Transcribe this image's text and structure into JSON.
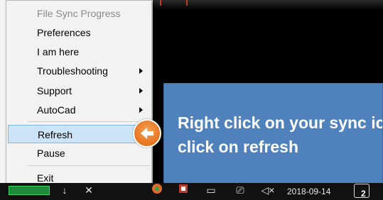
{
  "context_menu": {
    "title": "File Sync Progress",
    "items": [
      {
        "label": "Preferences"
      },
      {
        "label": "I am here"
      },
      {
        "label": "Troubleshooting"
      },
      {
        "label": "Support"
      },
      {
        "label": "AutoCad"
      },
      {
        "label": "Refresh"
      },
      {
        "label": "Pause"
      },
      {
        "label": "Exit"
      }
    ]
  },
  "callout": {
    "line1": "Right click on your sync icon and",
    "line2": "click on refresh"
  },
  "taskbar": {
    "date": "2018-09-14",
    "notification_count": "2"
  },
  "colors": {
    "callout_bg": "#4f81bd",
    "highlight": "#cce4f7",
    "accent_orange": "#e6731e"
  }
}
